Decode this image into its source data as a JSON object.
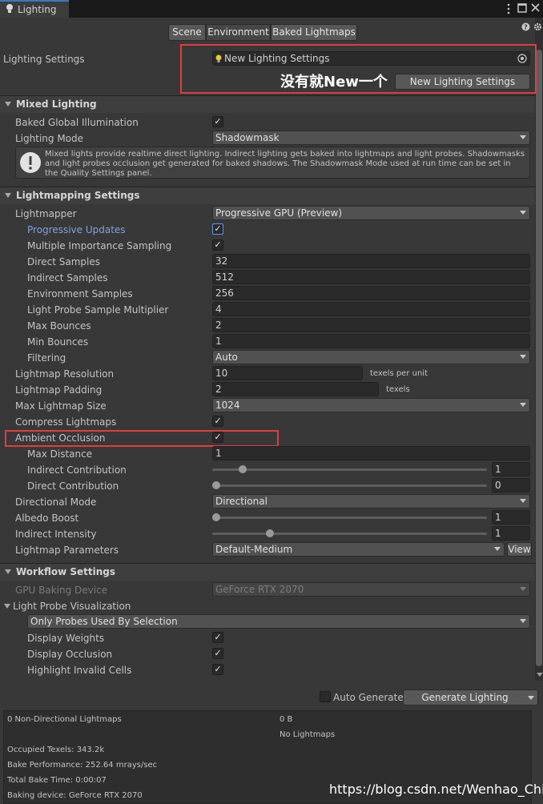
{
  "window": {
    "tab_title": "Lighting",
    "tab_icon": "lightbulb-icon",
    "controls": [
      "kebab-menu-icon",
      "maximize-icon",
      "close-icon"
    ]
  },
  "toolbar": {
    "tabs": [
      "Scene",
      "Environment",
      "Baked Lightmaps"
    ],
    "active_tab": "Environment",
    "help_icon": "help-icon",
    "settings_icon": "gear-icon"
  },
  "lighting_settings": {
    "label": "Lighting Settings",
    "asset_value": "New Lighting Settings",
    "new_button": "New Lighting Settings",
    "annotation": "没有就New一个"
  },
  "mixed_lighting": {
    "title": "Mixed Lighting",
    "baked_gi_label": "Baked Global Illumination",
    "baked_gi_checked": true,
    "lighting_mode_label": "Lighting Mode",
    "lighting_mode_value": "Shadowmask",
    "help_text": "Mixed lights provide realtime direct lighting. Indirect lighting gets baked into lightmaps and light probes. Shadowmasks and light probes occlusion get generated for baked shadows. The Shadowmask Mode used at run time can be set in the Quality Settings panel."
  },
  "lightmapping": {
    "title": "Lightmapping Settings",
    "lightmapper_label": "Lightmapper",
    "lightmapper_value": "Progressive GPU (Preview)",
    "progressive_updates_label": "Progressive Updates",
    "progressive_updates_checked": true,
    "mis_label": "Multiple Importance Sampling",
    "mis_checked": true,
    "direct_samples_label": "Direct Samples",
    "direct_samples_value": "32",
    "indirect_samples_label": "Indirect Samples",
    "indirect_samples_value": "512",
    "env_samples_label": "Environment Samples",
    "env_samples_value": "256",
    "probe_mult_label": "Light Probe Sample Multiplier",
    "probe_mult_value": "4",
    "max_bounces_label": "Max Bounces",
    "max_bounces_value": "2",
    "min_bounces_label": "Min Bounces",
    "min_bounces_value": "1",
    "filtering_label": "Filtering",
    "filtering_value": "Auto",
    "resolution_label": "Lightmap Resolution",
    "resolution_value": "10",
    "resolution_unit": "texels per unit",
    "padding_label": "Lightmap Padding",
    "padding_value": "2",
    "padding_unit": "texels",
    "max_size_label": "Max Lightmap Size",
    "max_size_value": "1024",
    "compress_label": "Compress Lightmaps",
    "compress_checked": true,
    "ao_label": "Ambient Occlusion",
    "ao_checked": true,
    "max_distance_label": "Max Distance",
    "max_distance_value": "1",
    "indirect_contrib_label": "Indirect Contribution",
    "indirect_contrib_value": "1",
    "indirect_contrib_fraction": 0.1,
    "direct_contrib_label": "Direct Contribution",
    "direct_contrib_value": "0",
    "direct_contrib_fraction": 0.0,
    "directional_mode_label": "Directional Mode",
    "directional_mode_value": "Directional",
    "albedo_boost_label": "Albedo Boost",
    "albedo_boost_value": "1",
    "albedo_boost_fraction": 0.0,
    "indirect_intensity_label": "Indirect Intensity",
    "indirect_intensity_value": "1",
    "indirect_intensity_fraction": 0.2,
    "params_label": "Lightmap Parameters",
    "params_value": "Default-Medium",
    "view_button": "View"
  },
  "workflow": {
    "title": "Workflow Settings",
    "gpu_device_label": "GPU Baking Device",
    "gpu_device_value": "GeForce RTX 2070",
    "probe_vis_label": "Light Probe Visualization",
    "probe_vis_value": "Only Probes Used By Selection",
    "display_weights_label": "Display Weights",
    "display_weights_checked": true,
    "display_occlusion_label": "Display Occlusion",
    "display_occlusion_checked": true,
    "highlight_invalid_label": "Highlight Invalid Cells",
    "highlight_invalid_checked": true
  },
  "generate": {
    "auto_generate_label": "Auto Generate",
    "auto_generate_checked": false,
    "generate_button": "Generate Lighting"
  },
  "stats": {
    "lightmaps_label": "0 Non-Directional Lightmaps",
    "lightmaps_size": "0 B",
    "no_lightmaps": "No Lightmaps",
    "occupied_texels": "Occupied Texels: 343.2k",
    "bake_performance": "Bake Performance: 252.64 mrays/sec",
    "total_bake_time": "Total Bake Time: 0:00:07",
    "baking_device": "Baking device: GeForce RTX 2070"
  },
  "watermark": "https://blog.csdn.net/Wenhao_China",
  "colors": {
    "accent": "#3a79bb",
    "highlight_box": "#e53b3b",
    "blue_label": "#7ba4e0",
    "background": "#383838"
  }
}
